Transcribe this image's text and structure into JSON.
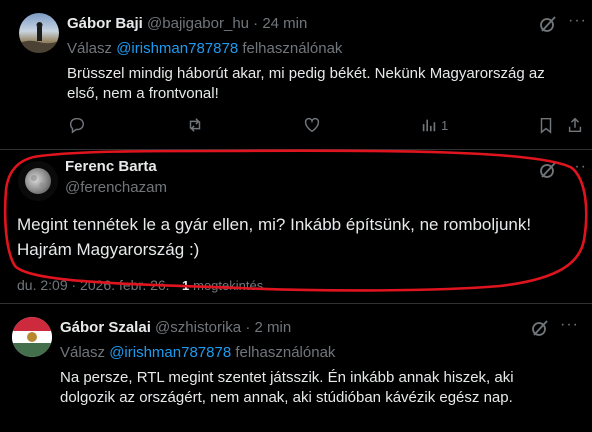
{
  "posts": [
    {
      "name": "Gábor Baji",
      "handle": "@bajigabor_hu",
      "time": "· 24 min",
      "reply_prefix": "Válasz",
      "reply_to": "@irishman787878",
      "reply_suffix": "felhasználónak",
      "text": "Brüsszel mindig háborút akar, mi pedig békét. Nekünk Magyarország az első, nem a frontvonal!",
      "views": "1"
    },
    {
      "name": "Ferenc Barta",
      "handle": "@ferenchazam",
      "text": "Megint tennétek le a gyár ellen, mi? Inkább építsünk, ne romboljunk! Hajrám Magyarország :)",
      "timestamp": "du. 2:09 · 2026. febr. 26. ·",
      "views_count": "1",
      "views_label": "megtekintés"
    },
    {
      "name": "Gábor Szalai",
      "handle": "@szhistorika",
      "time": "· 2 min",
      "reply_prefix": "Válasz",
      "reply_to": "@irishman787878",
      "reply_suffix": "felhasználónak",
      "text": "Na persze, RTL megint szentet játsszik. Én inkább annak hiszek, aki dolgozik az országért, nem annak, aki stúdióban kávézik egész nap."
    }
  ],
  "icons": {
    "reply": "reply-icon",
    "retweet": "retweet-icon",
    "like": "heart-icon",
    "views": "views-icon",
    "bookmark": "bookmark-icon",
    "share": "share-icon",
    "grok": "grok-icon",
    "more": "more-icon"
  },
  "colors": {
    "background": "#000000",
    "text": "#e7e9ea",
    "muted": "#71767b",
    "link": "#1d9bf0",
    "divider": "#2f3336",
    "annotation": "#e0141e"
  }
}
